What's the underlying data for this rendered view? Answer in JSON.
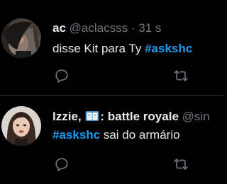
{
  "tweets": [
    {
      "name": "ac",
      "handle": "@aclacsss",
      "separator": "·",
      "time": "31 s",
      "text_before": "disse Kit para Ty ",
      "hashtag": "#askshc",
      "text_after": "",
      "avatar": "avatar-photo",
      "actions": [
        "reply-icon",
        "retweet-icon"
      ]
    },
    {
      "name_part1": "Izzie, ",
      "name_part2": ": battle royale",
      "name_emoji": "open-book-icon",
      "handle": "@sin",
      "hashtag": "#askshc",
      "text_after": " sai do armário",
      "avatar": "avatar-photo",
      "actions": [
        "reply-icon",
        "retweet-icon"
      ]
    }
  ],
  "colors": {
    "background": "#000000",
    "text": "#e7e9ea",
    "muted": "#71767b",
    "hashtag": "#1d9bf0",
    "divider": "#2f3336"
  }
}
